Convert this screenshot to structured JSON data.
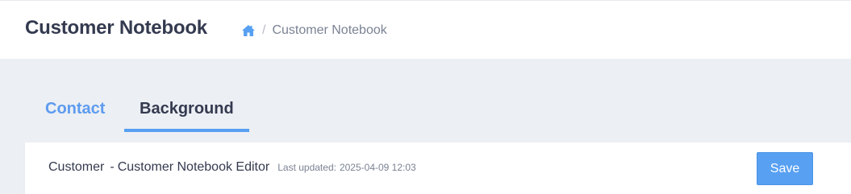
{
  "header": {
    "title": "Customer Notebook",
    "breadcrumb": {
      "home_icon": "home-icon",
      "separator": "/",
      "current": "Customer Notebook"
    }
  },
  "tabs": [
    {
      "label": "Contact",
      "active": false
    },
    {
      "label": "Background",
      "active": true
    }
  ],
  "panel": {
    "entity": "Customer",
    "dash": "-",
    "title": "Customer Notebook Editor",
    "last_updated_label": "Last updated:",
    "last_updated_value": "2025-04-09 12:03",
    "save_label": "Save"
  },
  "colors": {
    "accent": "#57a0f2",
    "tab_inactive": "#5d9bef",
    "text_dark": "#343a4f",
    "text_muted": "#7a8293",
    "page_bg": "#eceff4"
  }
}
